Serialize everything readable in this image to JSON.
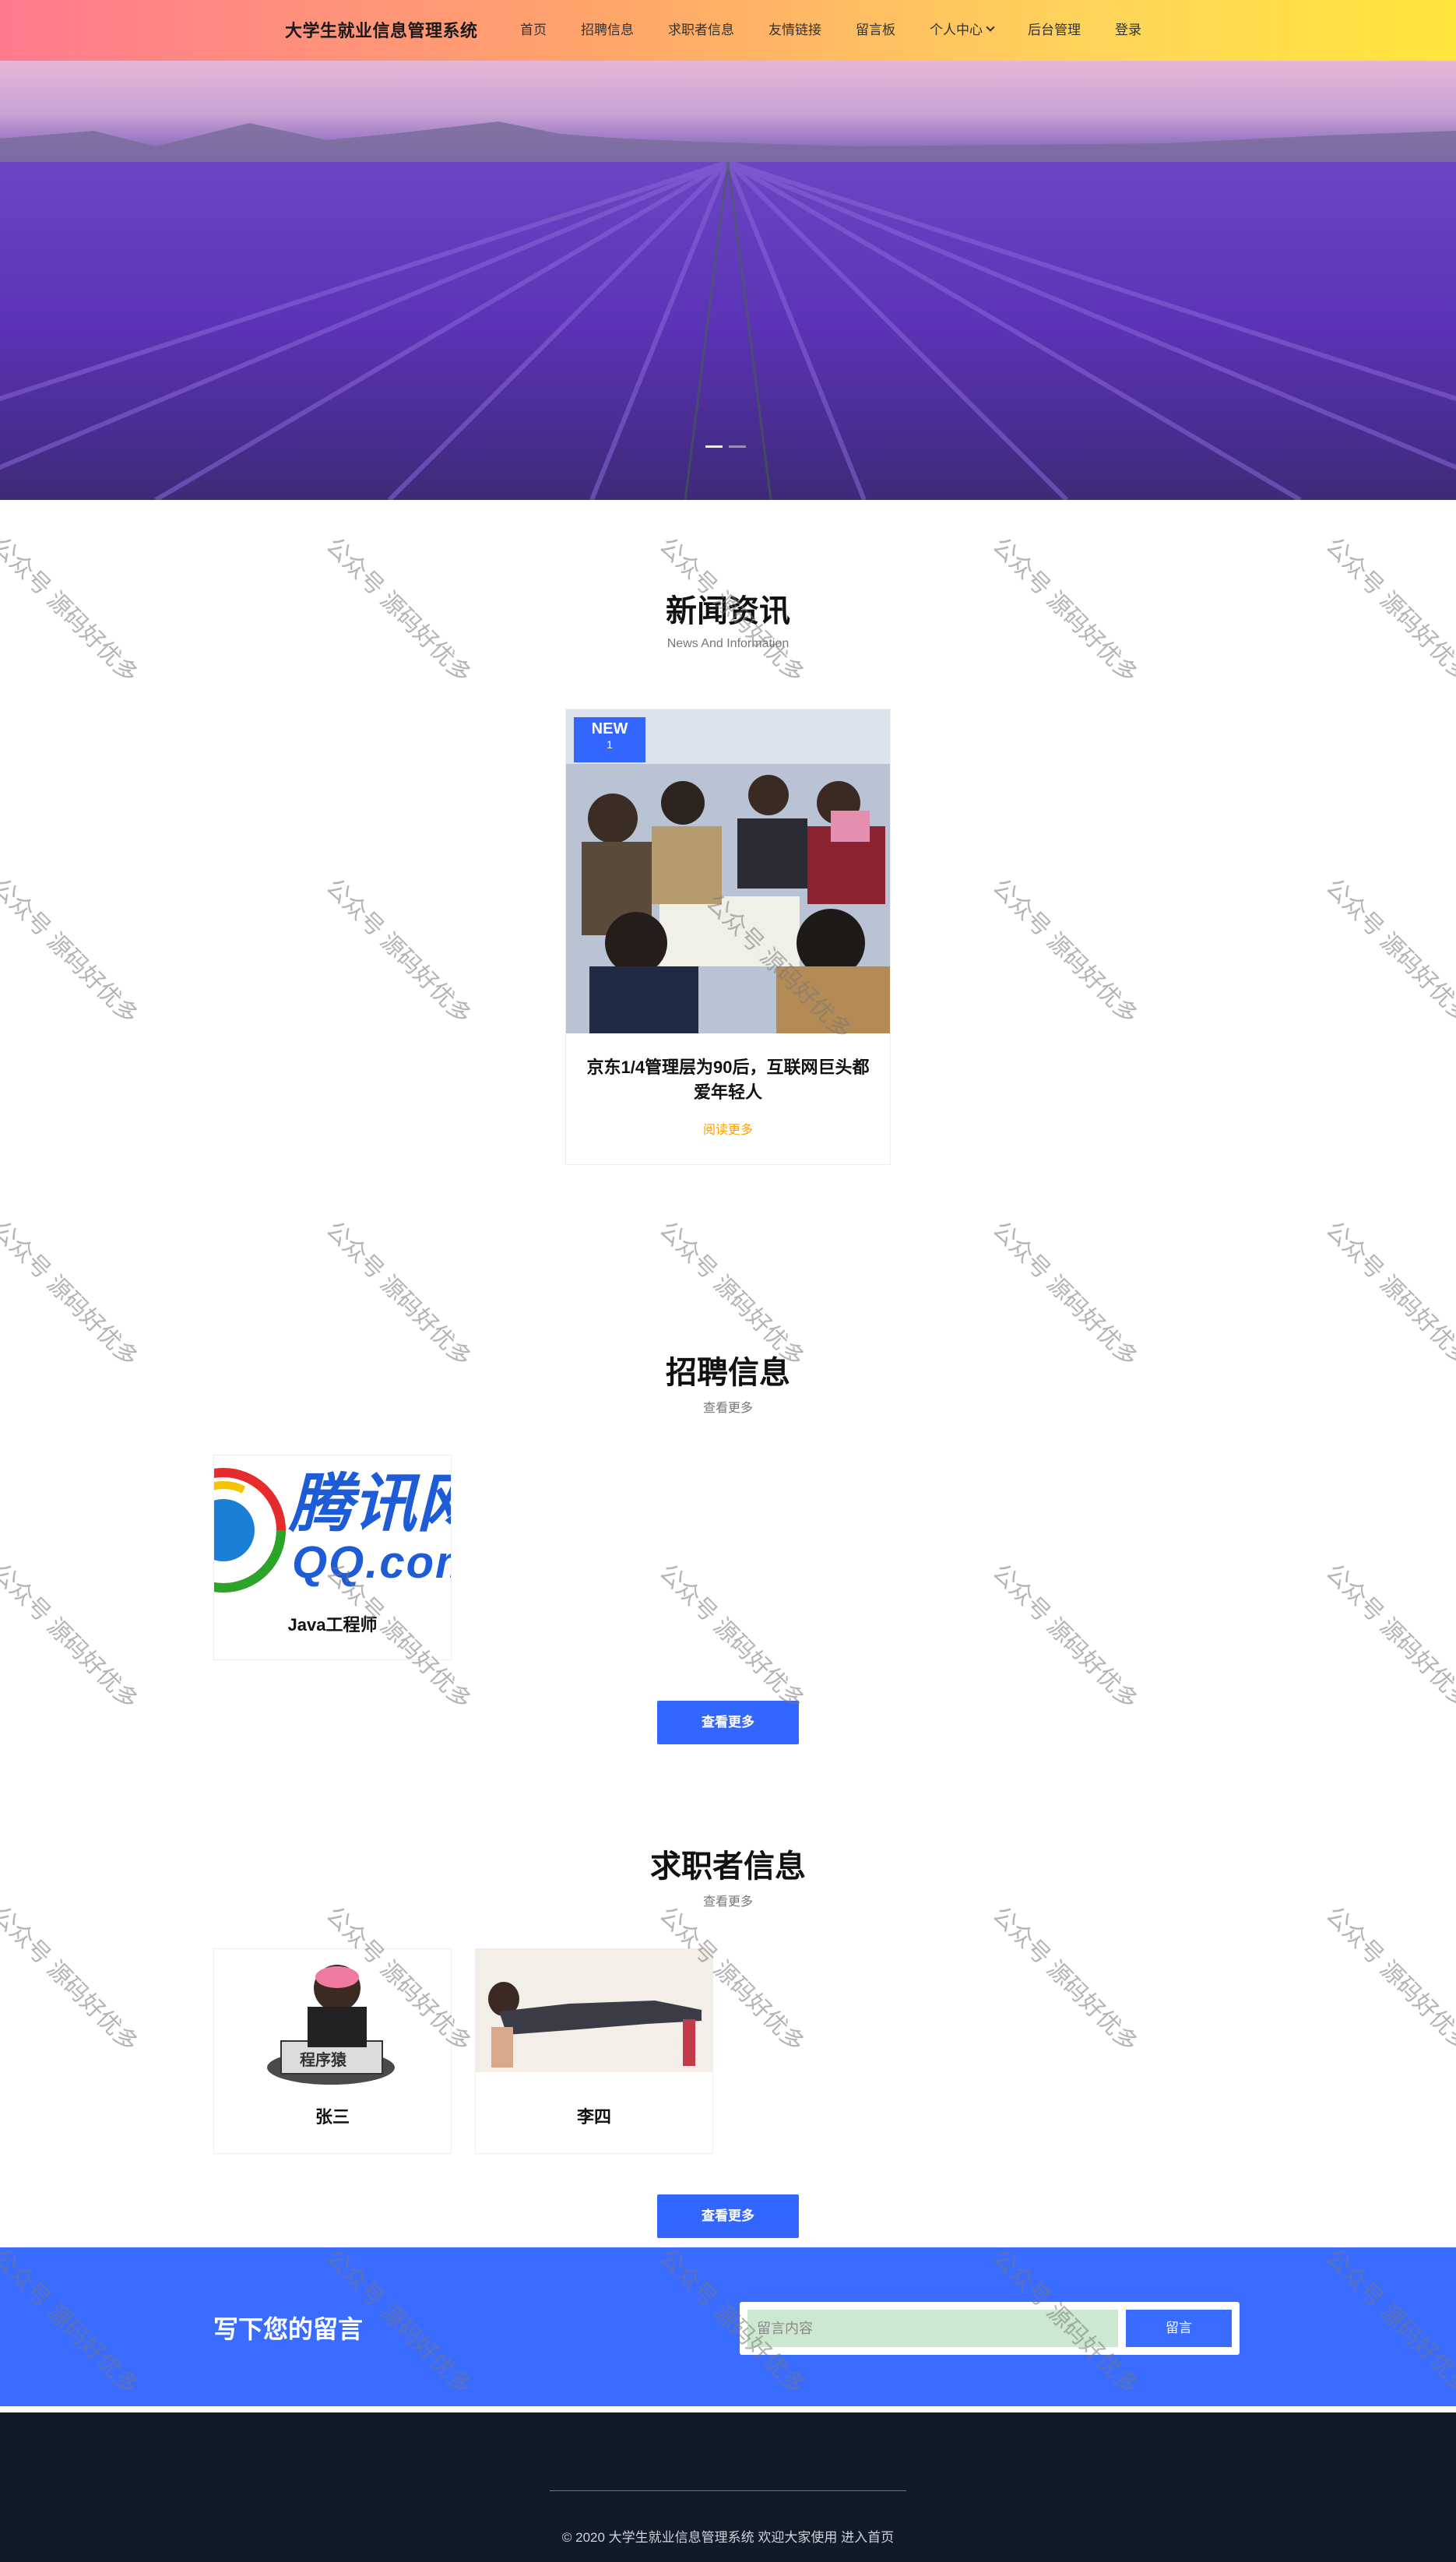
{
  "header": {
    "brand": "大学生就业信息管理系统",
    "nav": [
      {
        "label": "首页"
      },
      {
        "label": "招聘信息"
      },
      {
        "label": "求职者信息"
      },
      {
        "label": "友情链接"
      },
      {
        "label": "留言板"
      },
      {
        "label": "个人中心",
        "has_dropdown": true
      },
      {
        "label": "后台管理"
      },
      {
        "label": "登录"
      }
    ]
  },
  "hero": {
    "dots": [
      {
        "active": true
      },
      {
        "active": false
      }
    ]
  },
  "news": {
    "title": "新闻资讯",
    "subtitle": "News And Information",
    "card": {
      "badge_label": "NEW",
      "badge_number": "1",
      "title": "京东1/4管理层为90后，互联网巨头都爱年轻人",
      "more": "阅读更多"
    }
  },
  "jobs": {
    "title": "招聘信息",
    "subtitle": "查看更多",
    "items": [
      {
        "name": "Java工程师",
        "logo_text": "腾讯网",
        "logo_sub": "QQ.com"
      }
    ],
    "more_button": "查看更多"
  },
  "seekers": {
    "title": "求职者信息",
    "subtitle": "查看更多",
    "items": [
      {
        "name": "张三",
        "image_caption": "程序猿"
      },
      {
        "name": "李四"
      }
    ],
    "more_button": "查看更多"
  },
  "message": {
    "title": "写下您的留言",
    "placeholder": "留言内容",
    "submit": "留言"
  },
  "footer": {
    "text": "© 2020 大学生就业信息管理系统 欢迎大家使用 进入首页"
  },
  "watermark": {
    "text": "公众号 源码好优多"
  },
  "colors": {
    "primary": "#3366ff",
    "accent": "#ff9f00",
    "footer_bg": "#111a28"
  }
}
